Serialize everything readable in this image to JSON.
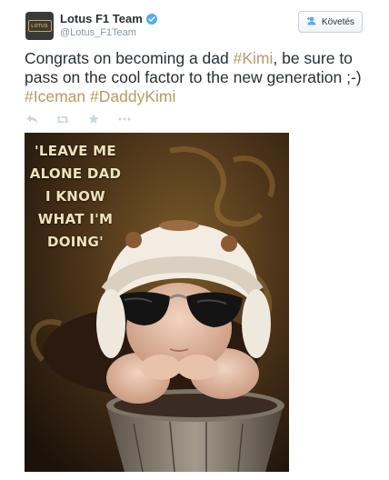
{
  "tweet": {
    "display_name": "Lotus F1 Team",
    "handle": "@Lotus_F1Team",
    "avatar_text": "LOTUS",
    "follow_label": "Követés",
    "text_parts": [
      {
        "text": "Congrats on becoming a dad ",
        "hashtag": false
      },
      {
        "text": "#Kimi",
        "hashtag": true
      },
      {
        "text": ", be sure to pass on the cool factor to the new generation ;-) ",
        "hashtag": false
      },
      {
        "text": "#Iceman",
        "hashtag": true
      },
      {
        "text": " ",
        "hashtag": false
      },
      {
        "text": "#DaddyKimi",
        "hashtag": true
      }
    ],
    "actions": [
      "reply-icon",
      "retweet-icon",
      "favorite-icon",
      "more-icon"
    ],
    "photo": {
      "caption_lines": [
        "'LEAVE ME",
        "ALONE DAD",
        "I KNOW",
        "WHAT I'M",
        "DOING'"
      ]
    }
  },
  "colors": {
    "hashtag": "#b69b66",
    "verified": "#55acee",
    "text": "#292f33",
    "muted": "#8899a6"
  }
}
